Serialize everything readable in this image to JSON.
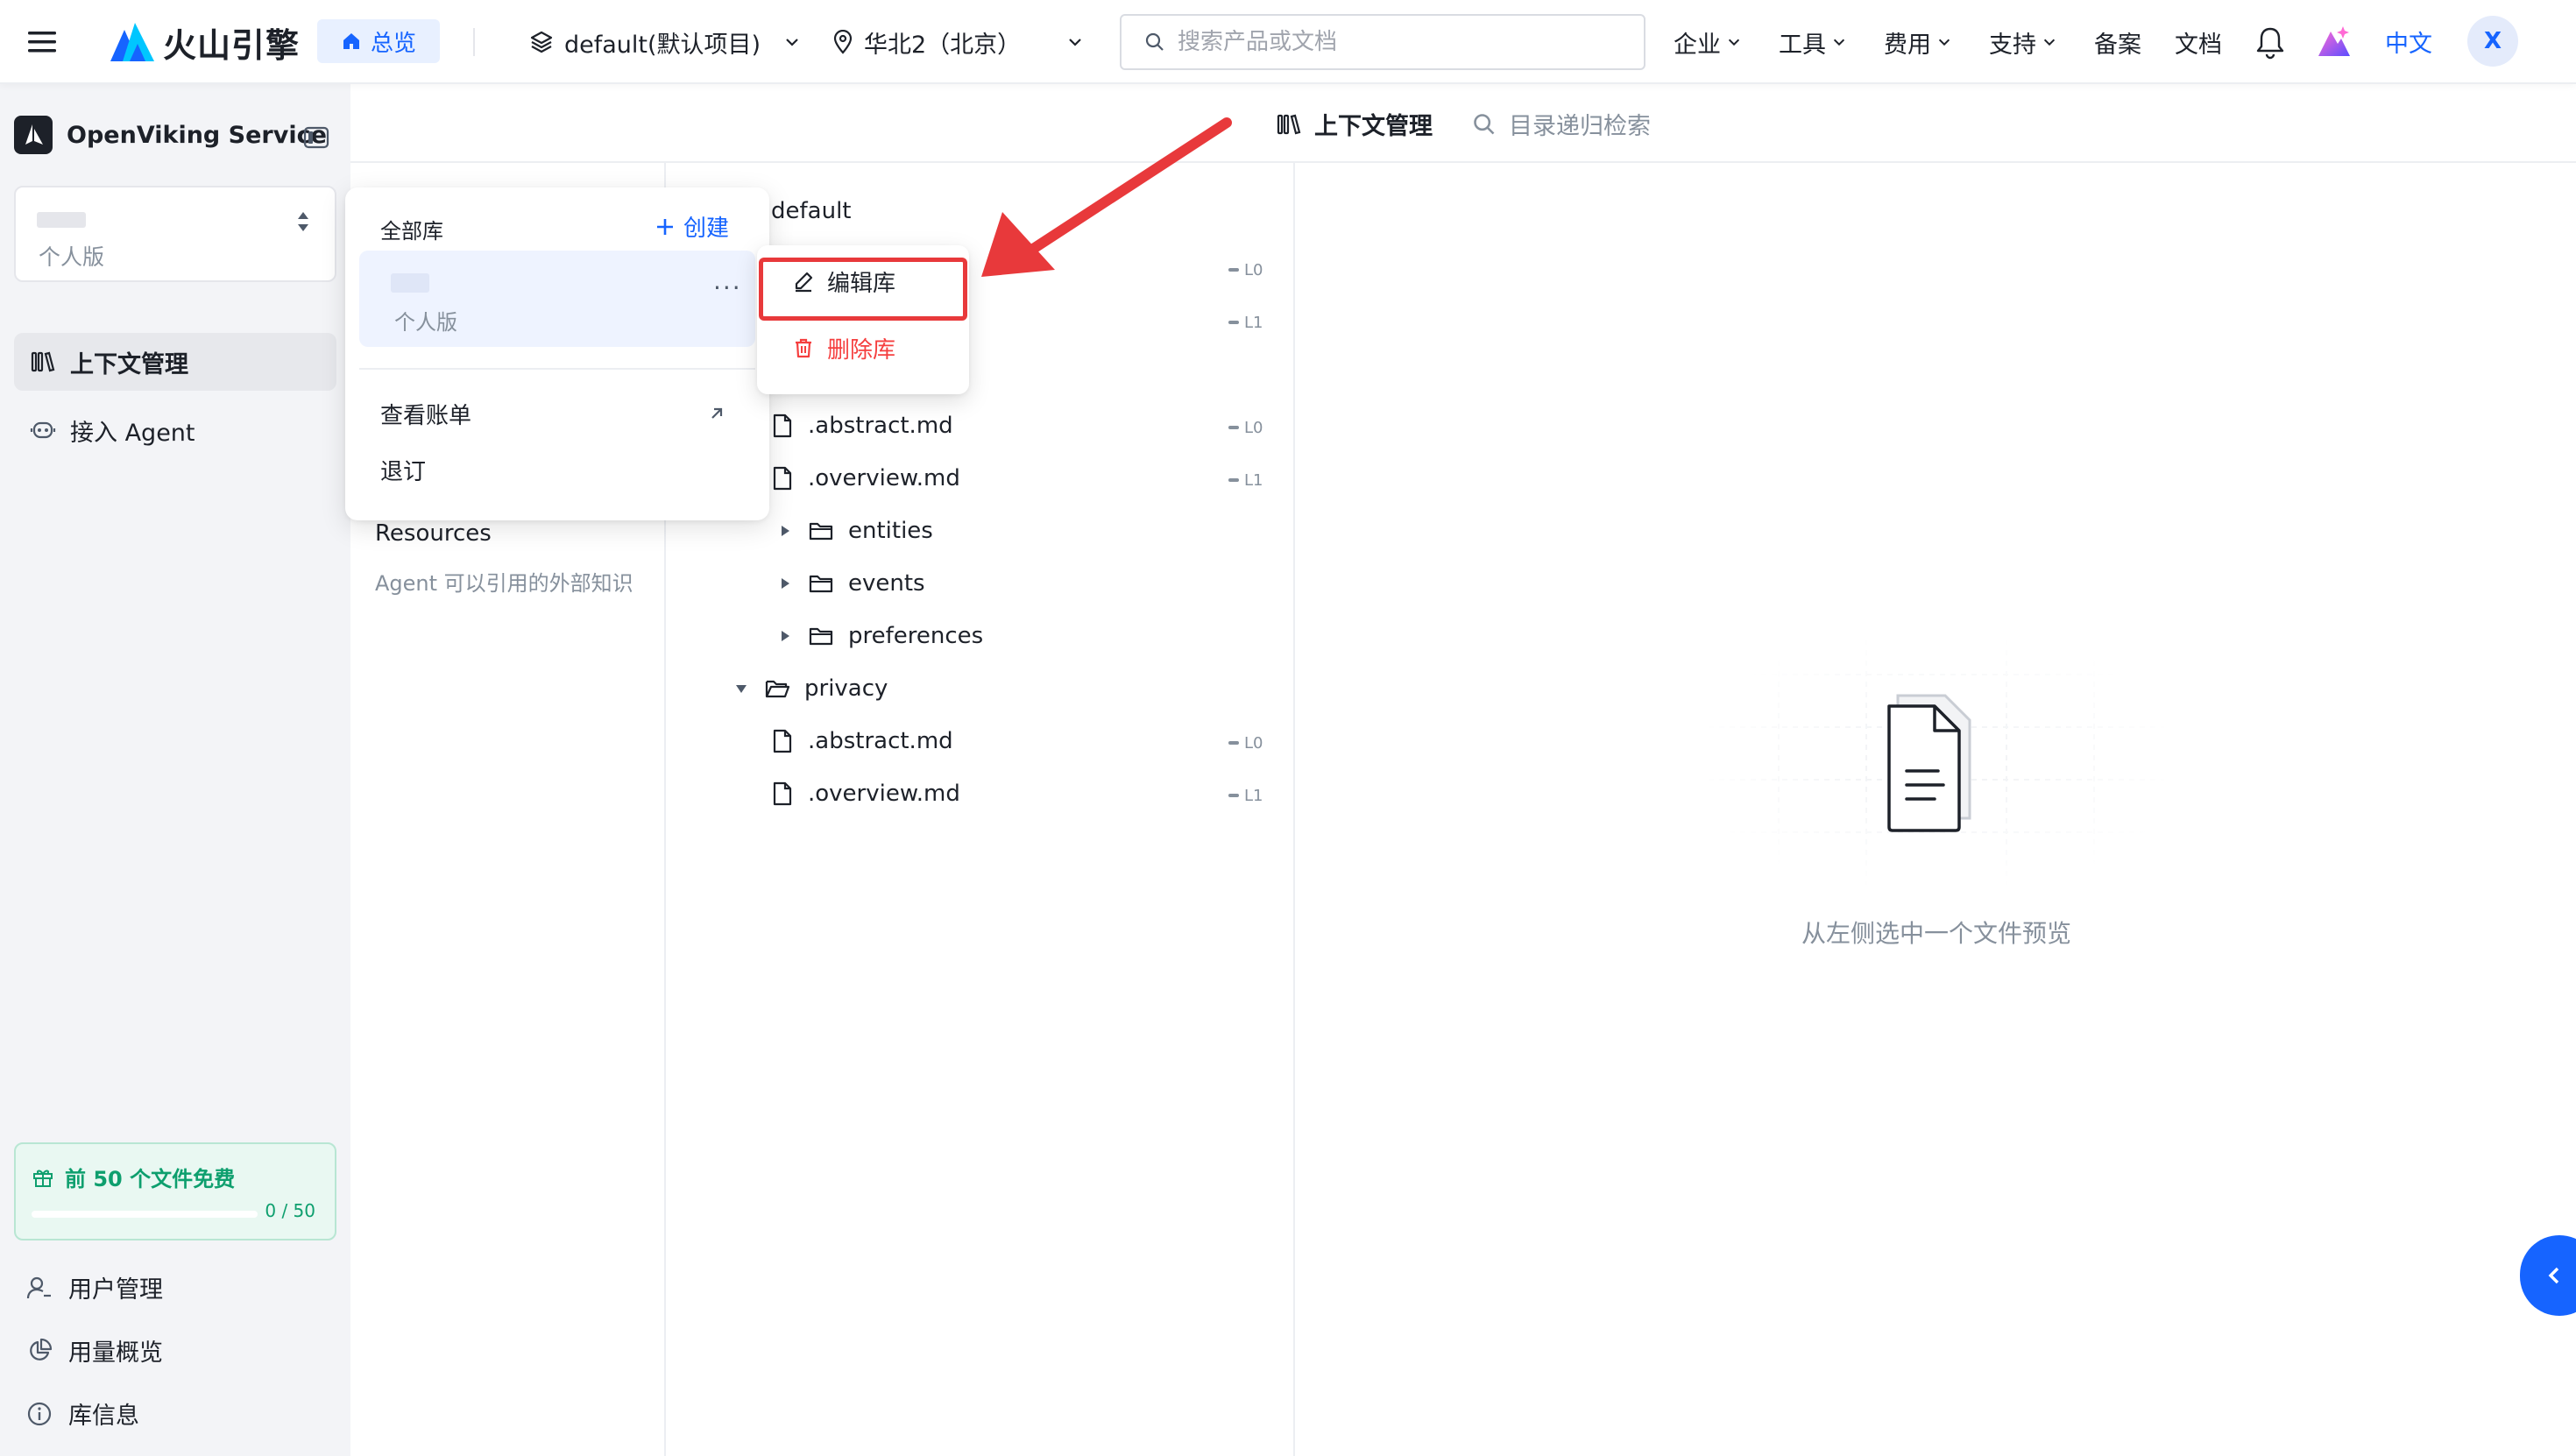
{
  "topbar": {
    "brand": "火山引擎",
    "overview": "总览",
    "project": "default(默认项目)",
    "region": "华北2（北京）",
    "search_placeholder": "搜索产品或文档",
    "nav": [
      "企业",
      "工具",
      "费用",
      "支持"
    ],
    "nav_plain": [
      "备案",
      "文档"
    ],
    "lang": "中文",
    "avatar": "X"
  },
  "sidebar": {
    "service_name": "OpenViking Service",
    "library_edition": "个人版",
    "items": [
      {
        "label": "上下文管理",
        "icon": "library-icon",
        "active": true
      },
      {
        "label": "接入 Agent",
        "icon": "agent-icon",
        "active": false
      }
    ],
    "free_card": {
      "title": "前 50 个文件免费",
      "count": "0 / 50",
      "progress": 0
    },
    "bottom_items": [
      {
        "label": "用户管理",
        "icon": "user-icon"
      },
      {
        "label": "用量概览",
        "icon": "pie-chart-icon"
      },
      {
        "label": "库信息",
        "icon": "info-icon"
      }
    ]
  },
  "tabs": [
    {
      "label": "上下文管理",
      "active": true,
      "icon": "library-icon"
    },
    {
      "label": "目录递归检索",
      "active": false,
      "icon": "search-icon"
    }
  ],
  "resources": {
    "name": "Resources",
    "desc": "Agent 可以引用的外部知识"
  },
  "tree": {
    "root": "default",
    "rows": [
      {
        "label": ".abstract.md",
        "type": "file",
        "level": "L0"
      },
      {
        "label": ".overview.md",
        "type": "file",
        "level": "L1"
      },
      {
        "label": "entities",
        "type": "folder",
        "expanded": false
      },
      {
        "label": "events",
        "type": "folder",
        "expanded": false
      },
      {
        "label": "preferences",
        "type": "folder",
        "expanded": false
      },
      {
        "label": "privacy",
        "type": "folder",
        "expanded": true
      },
      {
        "label": ".abstract.md",
        "type": "file",
        "level": "L0"
      },
      {
        "label": ".overview.md",
        "type": "file",
        "level": "L1"
      }
    ],
    "hidden_levels": [
      "L0",
      "L1"
    ]
  },
  "preview": {
    "empty_text": "从左侧选中一个文件预览"
  },
  "library_dropdown": {
    "header": "全部库",
    "create": "创建",
    "item_edition": "个人版",
    "more": "···",
    "bill": "查看账单",
    "unsubscribe": "退订"
  },
  "context_menu": {
    "edit": "编辑库",
    "delete": "删除库"
  },
  "colors": {
    "accent": "#1664ff",
    "danger": "#f53f3f",
    "highlight": "#e8393b",
    "free": "#0e9f6e"
  }
}
